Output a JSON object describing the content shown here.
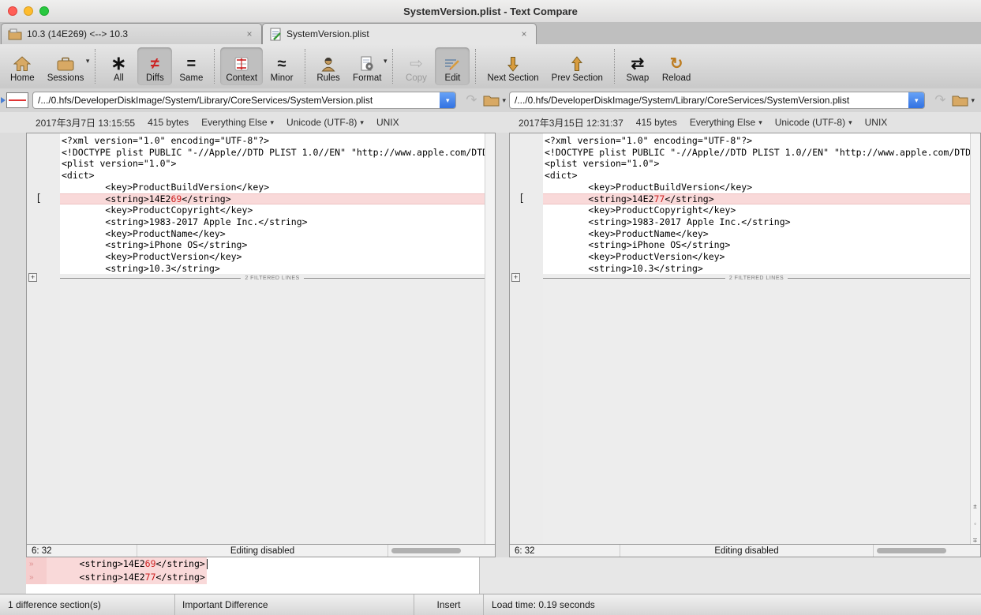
{
  "window": {
    "title": "SystemVersion.plist - Text Compare"
  },
  "tabs": [
    {
      "label": "10.3 (14E269) <--> 10.3",
      "active": false
    },
    {
      "label": "SystemVersion.plist",
      "active": true
    }
  ],
  "icons": {
    "caret_down": "▾",
    "close": "×",
    "asterisk": "∗",
    "not_equal": "≠",
    "equals": "=",
    "approx": "≈",
    "copy_arrow": "⇨",
    "swap": "⇄",
    "reload": "↻",
    "share_arrow": "↷",
    "guillemet": "»",
    "plus": "+",
    "edge_buttons": [
      "±",
      "◦",
      "∓"
    ]
  },
  "toolbar": {
    "items": [
      {
        "label": "Home"
      },
      {
        "label": "Sessions"
      },
      {
        "label": "All"
      },
      {
        "label": "Diffs"
      },
      {
        "label": "Same"
      },
      {
        "label": "Context"
      },
      {
        "label": "Minor"
      },
      {
        "label": "Rules"
      },
      {
        "label": "Format"
      },
      {
        "label": "Copy"
      },
      {
        "label": "Edit"
      },
      {
        "label": "Next Section"
      },
      {
        "label": "Prev Section"
      },
      {
        "label": "Swap"
      },
      {
        "label": "Reload"
      }
    ]
  },
  "file_bars": {
    "left": {
      "path": "/.../0.hfs/DeveloperDiskImage/System/Library/CoreServices/SystemVersion.plist"
    },
    "right": {
      "path": "/.../0.hfs/DeveloperDiskImage/System/Library/CoreServices/SystemVersion.plist"
    }
  },
  "file_info": {
    "left": {
      "modified": "2017年3月7日 13:15:55",
      "size": "415 bytes",
      "display_filter": "Everything Else",
      "encoding": "Unicode (UTF-8)",
      "line_ending": "UNIX"
    },
    "right": {
      "modified": "2017年3月15日 12:31:37",
      "size": "415 bytes",
      "display_filter": "Everything Else",
      "encoding": "Unicode (UTF-8)",
      "line_ending": "UNIX"
    }
  },
  "code": {
    "diff_marker": "[",
    "filtered_label": "2 FILTERED LINES",
    "lines": [
      {
        "t": "<?xml version=\"1.0\" encoding=\"UTF-8\"?>"
      },
      {
        "t": "<!DOCTYPE plist PUBLIC \"-//Apple//DTD PLIST 1.0//EN\" \"http://www.apple.com/DTDs"
      },
      {
        "t": "<plist version=\"1.0\">"
      },
      {
        "t": "<dict>"
      },
      {
        "t": "\t<key>ProductBuildVersion</key>"
      },
      {
        "diff": true,
        "pre": "\t<string>14E2",
        "changed": {
          "left": "69",
          "right": "77"
        },
        "post": "</string>"
      },
      {
        "t": "\t<key>ProductCopyright</key>"
      },
      {
        "t": "\t<string>1983-2017 Apple Inc.</string>"
      },
      {
        "t": "\t<key>ProductName</key>"
      },
      {
        "t": "\t<string>iPhone OS</string>"
      },
      {
        "t": "\t<key>ProductVersion</key>"
      },
      {
        "t": "\t<string>10.3</string>"
      }
    ]
  },
  "pane_status": {
    "left": {
      "cursor": "6: 32",
      "status": "Editing disabled"
    },
    "right": {
      "cursor": "6: 32",
      "status": "Editing disabled"
    }
  },
  "detail": {
    "rows": [
      {
        "pre": "\t<string>14E2",
        "hl": "69",
        "post": "</string>"
      },
      {
        "pre": "\t<string>14E2",
        "hl": "77",
        "post": "</string>"
      }
    ]
  },
  "status_bar": {
    "sections": "1 difference section(s)",
    "importance": "Important Difference",
    "mode": "Insert",
    "load_time": "Load time: 0.19 seconds"
  },
  "colors": {
    "diff_line_bg": "#f9d9d9",
    "diff_char_red": "#cc2020",
    "combo_accent_blue": "#3d86f0",
    "section_arrow_orange": "#d89c3e"
  }
}
